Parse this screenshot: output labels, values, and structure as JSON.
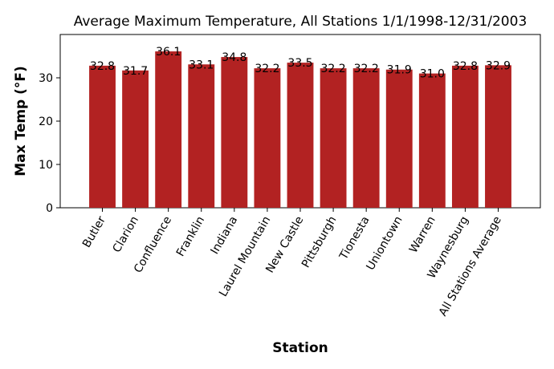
{
  "chart_data": {
    "type": "bar",
    "title": "Average Maximum Temperature, All Stations 1/1/1998-12/31/2003",
    "xlabel": "Station",
    "ylabel": "Max Temp (°F)",
    "ylim": [
      0,
      40
    ],
    "yticks": [
      "0",
      "10",
      "20",
      "30"
    ],
    "categories": [
      "Butler",
      "Clarion",
      "Confluence",
      "Franklin",
      "Indiana",
      "Laurel Mountain",
      "New Castle",
      "Pittsburgh",
      "Tionesta",
      "Uniontown",
      "Warren",
      "Waynesburg",
      "All Stations Average"
    ],
    "values": [
      32.8,
      31.7,
      36.1,
      33.1,
      34.8,
      32.2,
      33.5,
      32.2,
      32.2,
      31.9,
      31.0,
      32.8,
      32.9
    ],
    "value_labels": [
      "32.8",
      "31.7",
      "36.1",
      "33.1",
      "34.8",
      "32.2",
      "33.5",
      "32.2",
      "32.2",
      "31.9",
      "31.0",
      "32.8",
      "32.9"
    ],
    "bar_color": "#b22222",
    "grid": false,
    "legend": "none"
  }
}
